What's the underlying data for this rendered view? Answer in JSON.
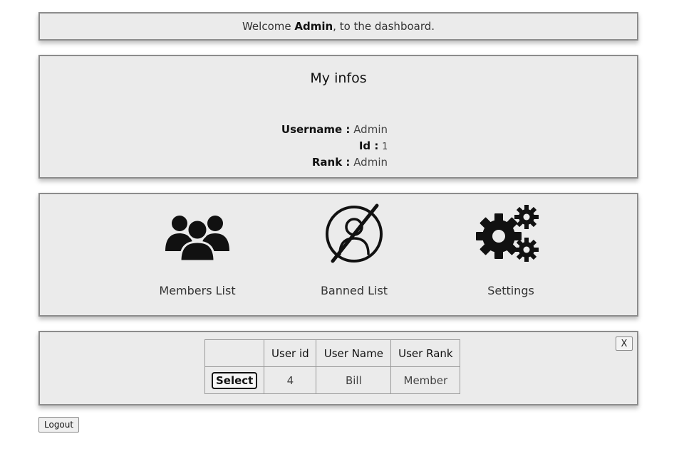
{
  "welcome": {
    "prefix": "Welcome ",
    "username": "Admin",
    "suffix": ", to the dashboard."
  },
  "infos": {
    "title": "My infos",
    "username_label": "Username :",
    "username_value": "Admin",
    "id_label": "Id :",
    "id_value": "1",
    "rank_label": "Rank :",
    "rank_value": "Admin"
  },
  "actions": [
    {
      "label": "Members List",
      "icon": "members-icon"
    },
    {
      "label": "Banned List",
      "icon": "banned-user-icon"
    },
    {
      "label": "Settings",
      "icon": "gears-icon"
    }
  ],
  "users_table": {
    "close_label": "X",
    "headers": [
      "",
      "User id",
      "User Name",
      "User Rank"
    ],
    "rows": [
      {
        "select_label": "Select",
        "id": "4",
        "name": "Bill",
        "rank": "Member"
      }
    ]
  },
  "logout_label": "Logout"
}
